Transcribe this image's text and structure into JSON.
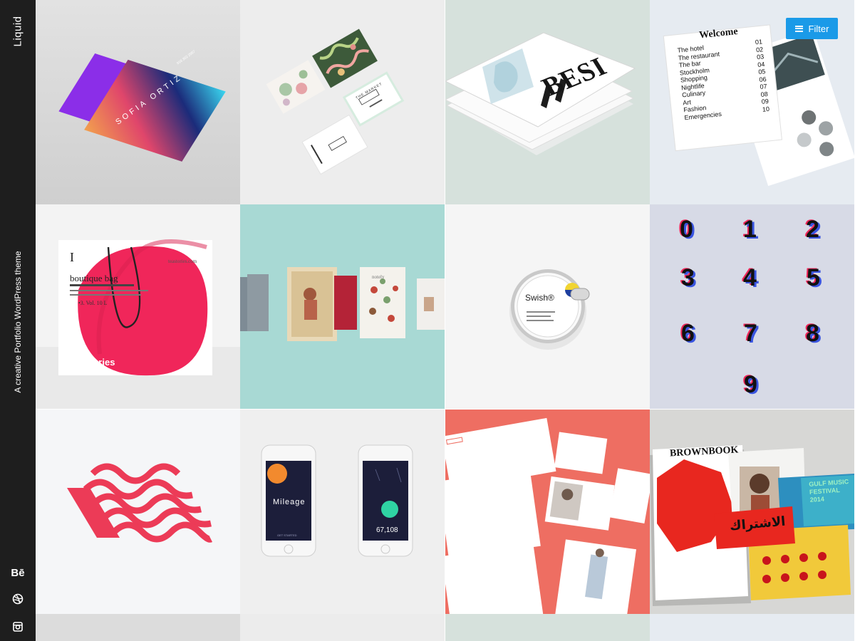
{
  "sidebar": {
    "brand": "Liquid",
    "tagline": "A creative Portfolio WordPress theme",
    "social": [
      {
        "icon": "behance-icon",
        "label": "Bē"
      },
      {
        "icon": "dribbble-icon"
      },
      {
        "icon": "instagram-icon"
      }
    ]
  },
  "filter": {
    "label": "Filter",
    "icon": "menu-icon"
  },
  "portfolio": {
    "items": [
      {
        "name": "Sofia Ortiz",
        "cards": [
          "SOFIA ORTIZ",
          "918 302 2087"
        ]
      },
      {
        "name": "The Market",
        "cards": [
          "THE MARKET"
        ]
      },
      {
        "name": "BESI",
        "cover_text": "BESI"
      },
      {
        "name": "Welcome",
        "title": "Welcome",
        "toc": [
          {
            "entry": "The hotel",
            "page": "01"
          },
          {
            "entry": "The restaurant",
            "page": "02"
          },
          {
            "entry": "The bar",
            "page": "03"
          },
          {
            "entry": "Stockholm",
            "page": "04"
          },
          {
            "entry": "Shopping",
            "page": "05"
          },
          {
            "entry": "Nightlife",
            "page": "06"
          },
          {
            "entry": "Culinary",
            "page": "07"
          },
          {
            "entry": "Art",
            "page": "08"
          },
          {
            "entry": "Fashion",
            "page": "09"
          },
          {
            "entry": "Emergencies",
            "page": "10"
          }
        ]
      },
      {
        "name": "teastories",
        "brand": "teastories",
        "heading": "boutique bag",
        "site": "teastories.com",
        "letter": "I",
        "volume": "•3. Vol. 10 L"
      },
      {
        "name": "notely",
        "brand": "notely"
      },
      {
        "name": "Swish",
        "brand": "Swish®"
      },
      {
        "name": "Numbers",
        "digits": [
          "0",
          "1",
          "2",
          "3",
          "4",
          "5",
          "6",
          "7",
          "8",
          "9"
        ]
      },
      {
        "name": "Waves logo"
      },
      {
        "name": "Mileage",
        "app_title": "Mileage",
        "counter": "67,108",
        "cta": "GET STARTED"
      },
      {
        "name": "Stationery"
      },
      {
        "name": "Brownbook",
        "title": "BROWNBOOK",
        "festival": "GULF MUSIC FESTIVAL 2014",
        "arabic": "الاشتراك"
      }
    ]
  },
  "colors": {
    "sidebar": "#1e1e1e",
    "accent": "#1a9ae8",
    "coral": "#ef6f63",
    "pink": "#f0265a",
    "mint": "#a7d8d4",
    "navy": "#1c1e3a"
  }
}
